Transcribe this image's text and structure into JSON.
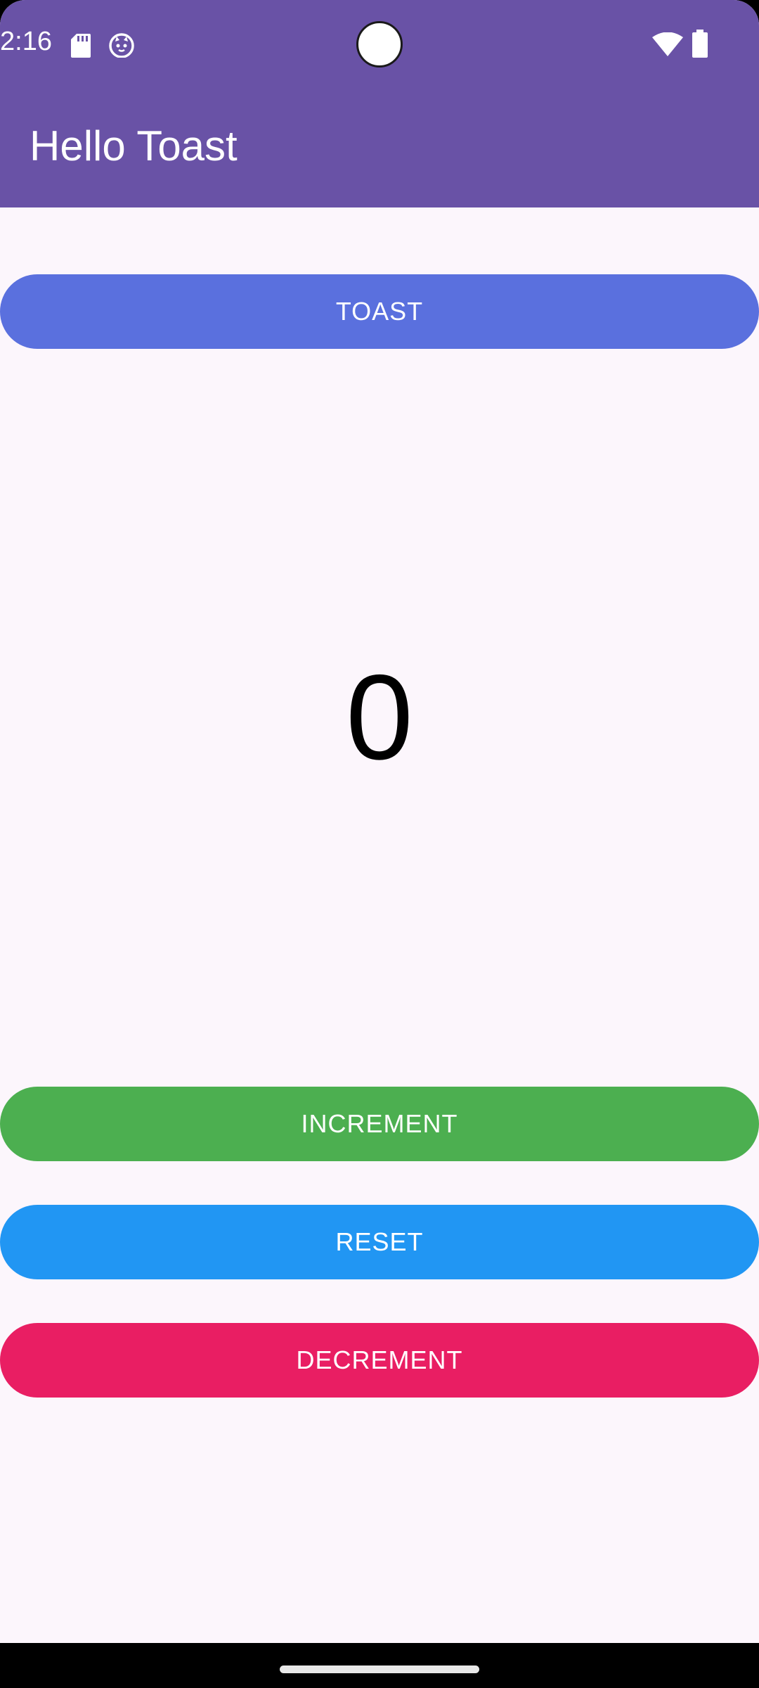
{
  "status_bar": {
    "time": "2:16",
    "icons": [
      "sd-card-icon",
      "cat-face-icon",
      "wifi-icon",
      "battery-icon"
    ]
  },
  "app_bar": {
    "title": "Hello Toast",
    "color": "#6952A6"
  },
  "buttons": {
    "toast": {
      "label": "TOAST",
      "color": "#5A70DE"
    },
    "increment": {
      "label": "INCREMENT",
      "color": "#4CAF50"
    },
    "reset": {
      "label": "RESET",
      "color": "#2196F3"
    },
    "decrement": {
      "label": "DECREMENT",
      "color": "#E91E63"
    }
  },
  "counter": {
    "value": "0"
  },
  "colors": {
    "background": "#FCF6FC",
    "header": "#6952A6"
  }
}
